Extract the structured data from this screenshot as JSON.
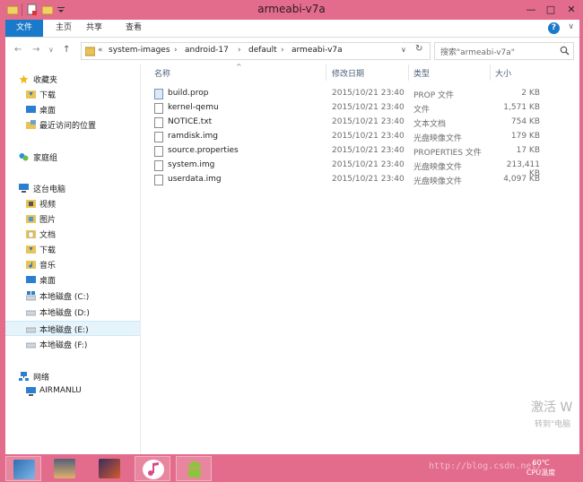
{
  "window": {
    "title": "armeabi-v7a",
    "minimize_label": "—",
    "maximize_label": "□",
    "close_label": "✕"
  },
  "ribbon": {
    "tabs": [
      {
        "label": "文件"
      },
      {
        "label": "主页"
      },
      {
        "label": "共享"
      },
      {
        "label": "查看"
      }
    ],
    "help_label": "?",
    "expand_label": "∨"
  },
  "nav": {
    "back_label": "←",
    "forward_label": "→",
    "recent_label": "∨",
    "up_label": "↑",
    "breadcrumbs": [
      "«",
      "system-images",
      "android-17",
      "default",
      "armeabi-v7a"
    ],
    "refresh_label": "↻",
    "dropdown_label": "∨",
    "search_placeholder": "搜索\"armeabi-v7a\"",
    "search_icon": "magnifier-icon"
  },
  "sidebar": {
    "favorites": {
      "label": "收藏夹",
      "items": [
        {
          "label": "下载"
        },
        {
          "label": "桌面"
        },
        {
          "label": "最近访问的位置"
        }
      ]
    },
    "homegroup": {
      "label": "家庭组"
    },
    "thispc": {
      "label": "这台电脑",
      "items": [
        {
          "label": "视频"
        },
        {
          "label": "图片"
        },
        {
          "label": "文档"
        },
        {
          "label": "下载"
        },
        {
          "label": "音乐"
        },
        {
          "label": "桌面"
        },
        {
          "label": "本地磁盘 (C:)"
        },
        {
          "label": "本地磁盘 (D:)"
        },
        {
          "label": "本地磁盘 (E:)"
        },
        {
          "label": "本地磁盘 (F:)"
        }
      ]
    },
    "network": {
      "label": "网络",
      "items": [
        {
          "label": "AIRMANLU"
        }
      ]
    }
  },
  "columns": {
    "name": "名称",
    "date": "修改日期",
    "type": "类型",
    "size": "大小"
  },
  "files": [
    {
      "name": "build.prop",
      "date": "2015/10/21 23:40",
      "type": "PROP 文件",
      "size": "2 KB"
    },
    {
      "name": "kernel-qemu",
      "date": "2015/10/21 23:40",
      "type": "文件",
      "size": "1,571 KB"
    },
    {
      "name": "NOTICE.txt",
      "date": "2015/10/21 23:40",
      "type": "文本文档",
      "size": "754 KB"
    },
    {
      "name": "ramdisk.img",
      "date": "2015/10/21 23:40",
      "type": "光盘映像文件",
      "size": "179 KB"
    },
    {
      "name": "source.properties",
      "date": "2015/10/21 23:40",
      "type": "PROPERTIES 文件",
      "size": "17 KB"
    },
    {
      "name": "system.img",
      "date": "2015/10/21 23:40",
      "type": "光盘映像文件",
      "size": "213,411 KB"
    },
    {
      "name": "userdata.img",
      "date": "2015/10/21 23:40",
      "type": "光盘映像文件",
      "size": "4,097 KB"
    }
  ],
  "activation": {
    "line1": "激活 W",
    "line2": "转到\"电脑"
  },
  "taskbar": {
    "temperature": "60℃",
    "temperature_label": "CPU温度",
    "watermark": "http://blog.csdn.net/"
  },
  "colors": {
    "frame": "#e36c8c",
    "accent": "#1979ca",
    "folder": "#e9c356"
  }
}
